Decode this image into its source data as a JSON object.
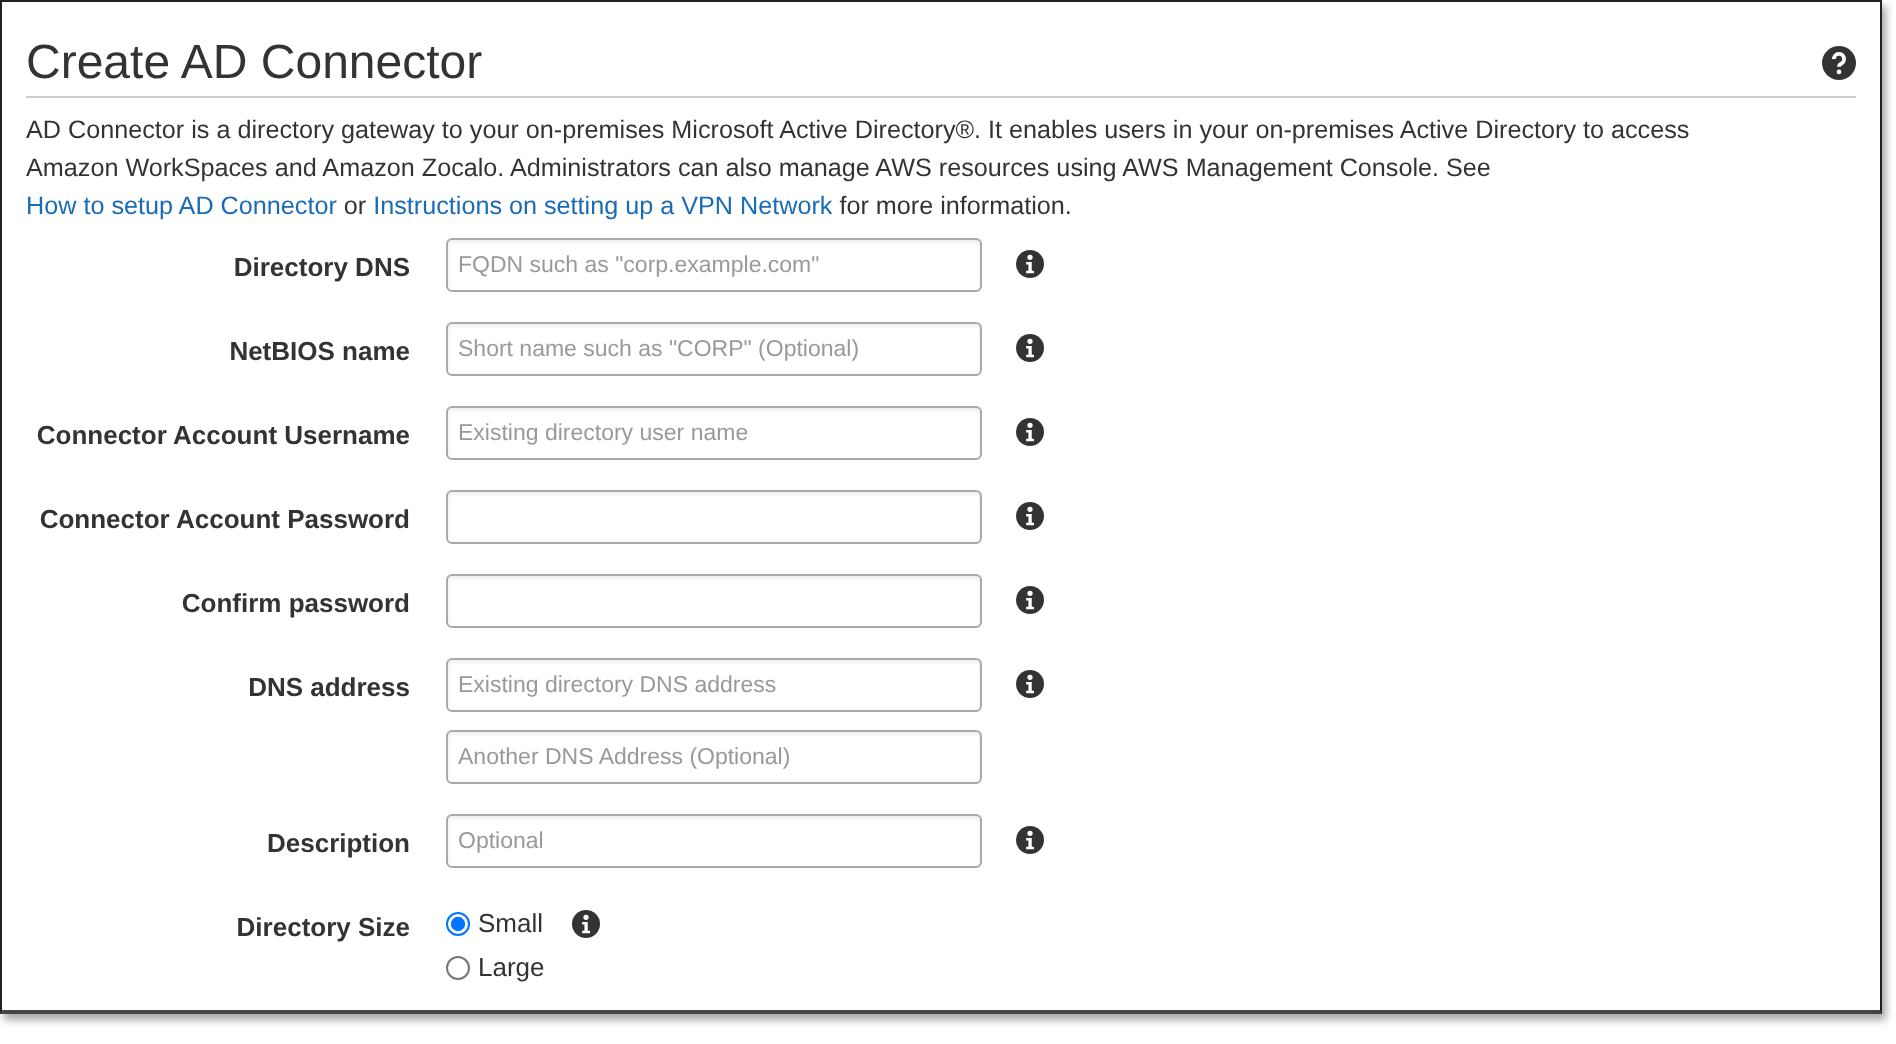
{
  "title": "Create AD Connector",
  "intro": [
    {
      "kind": "text",
      "text": "AD Connector is a directory gateway to your on-premises Microsoft Active Directory®. It enables users in your on-premises Active Directory to access Amazon WorkSpaces and Amazon Zocalo. Administrators can also manage AWS resources using AWS Management Console. See "
    },
    {
      "kind": "link",
      "text": "How to setup AD Connector"
    },
    {
      "kind": "text",
      "text": " or "
    },
    {
      "kind": "link",
      "text": "Instructions on setting up a VPN Network"
    },
    {
      "kind": "text",
      "text": " for more information."
    }
  ],
  "fields": [
    {
      "kind": "inputs",
      "label": "Directory DNS",
      "inputs": [
        {
          "placeholder": "FQDN such as \"corp.example.com\""
        }
      ]
    },
    {
      "kind": "inputs",
      "label": "NetBIOS name",
      "inputs": [
        {
          "placeholder": "Short name such as \"CORP\" (Optional)"
        }
      ]
    },
    {
      "kind": "inputs",
      "label": "Connector Account Username",
      "inputs": [
        {
          "placeholder": "Existing directory user name"
        }
      ]
    },
    {
      "kind": "blank_input",
      "label": "Connector Account Password"
    },
    {
      "kind": "blank_input",
      "label": "Confirm password"
    },
    {
      "kind": "inputs",
      "label": "DNS address",
      "inputs": [
        {
          "placeholder": "Existing directory DNS address"
        },
        {
          "placeholder": "Another DNS Address (Optional)"
        }
      ]
    },
    {
      "kind": "inputs",
      "label": "Description",
      "inputs": [
        {
          "placeholder": "Optional"
        }
      ]
    },
    {
      "kind": "radios",
      "label": "Directory Size",
      "options": [
        {
          "label": "Small",
          "selected": true
        },
        {
          "label": "Large",
          "selected": false
        }
      ]
    }
  ]
}
